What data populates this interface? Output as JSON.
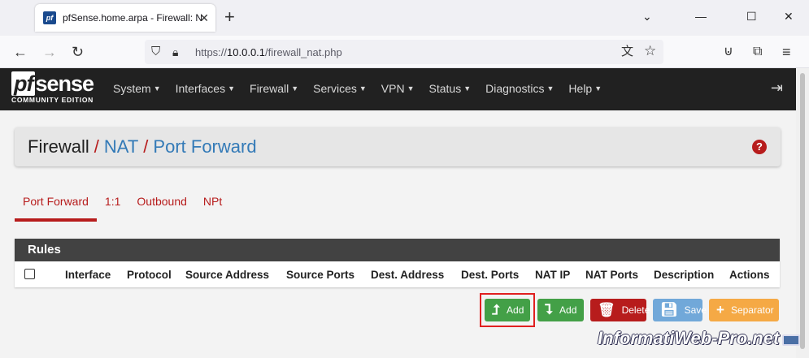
{
  "browser": {
    "tab_title": "pfSense.home.arpa - Firewall: NAT: Port Forward",
    "favicon_text": "pf",
    "tab_close": "✕",
    "new_tab": "+",
    "win_minimize": "⌄",
    "win_restore": "—",
    "win_max": "☐",
    "win_close": "✕",
    "url_scheme": "https://",
    "url_host": "10.0.0.1",
    "url_path": "/firewall_nat.php"
  },
  "header": {
    "logo_pf": "pf",
    "logo_sense": "sense",
    "logo_sub": "COMMUNITY EDITION",
    "menu": [
      {
        "label": "System"
      },
      {
        "label": "Interfaces"
      },
      {
        "label": "Firewall"
      },
      {
        "label": "Services"
      },
      {
        "label": "VPN"
      },
      {
        "label": "Status"
      },
      {
        "label": "Diagnostics"
      },
      {
        "label": "Help"
      }
    ]
  },
  "breadcrumb": {
    "root": "Firewall",
    "sep": "/",
    "level1": "NAT",
    "level2": "Port Forward",
    "help": "?"
  },
  "tabs": [
    {
      "label": "Port Forward",
      "active": true
    },
    {
      "label": "1:1",
      "active": false
    },
    {
      "label": "Outbound",
      "active": false
    },
    {
      "label": "NPt",
      "active": false
    }
  ],
  "rules": {
    "title": "Rules",
    "columns": [
      "Interface",
      "Protocol",
      "Source Address",
      "Source Ports",
      "Dest. Address",
      "Dest. Ports",
      "NAT IP",
      "NAT Ports",
      "Description",
      "Actions"
    ]
  },
  "buttons": {
    "add_top": "Add",
    "add_bottom": "Add",
    "delete": "Delete",
    "save": "Save",
    "separator": "Separator"
  },
  "watermark": "InformatiWeb-Pro.net",
  "colors": {
    "accent_red": "#b71c1c",
    "link_blue": "#337ab7",
    "header_dark": "#212121",
    "success": "#43a047"
  }
}
